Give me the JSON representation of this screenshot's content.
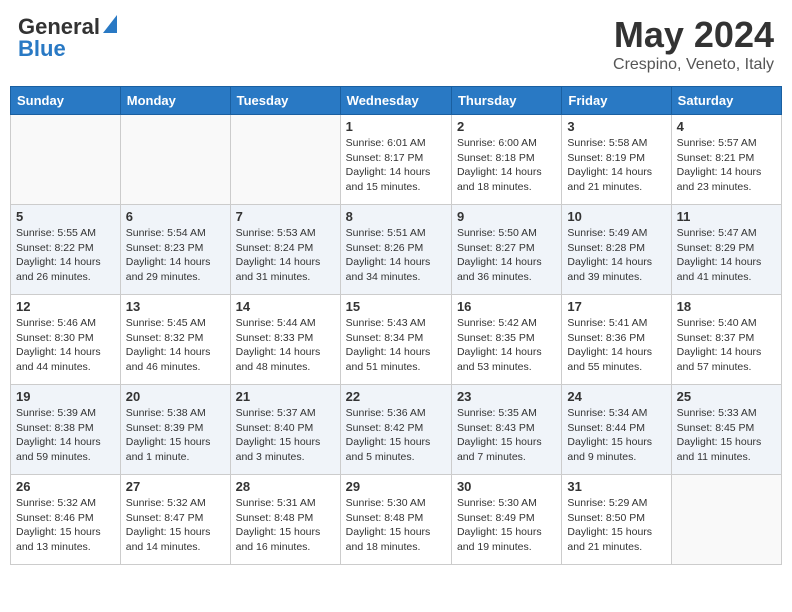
{
  "header": {
    "logo_general": "General",
    "logo_blue": "Blue",
    "month_title": "May 2024",
    "location": "Crespino, Veneto, Italy"
  },
  "days_of_week": [
    "Sunday",
    "Monday",
    "Tuesday",
    "Wednesday",
    "Thursday",
    "Friday",
    "Saturday"
  ],
  "weeks": [
    {
      "days": [
        {
          "number": "",
          "info": ""
        },
        {
          "number": "",
          "info": ""
        },
        {
          "number": "",
          "info": ""
        },
        {
          "number": "1",
          "info": "Sunrise: 6:01 AM\nSunset: 8:17 PM\nDaylight: 14 hours\nand 15 minutes."
        },
        {
          "number": "2",
          "info": "Sunrise: 6:00 AM\nSunset: 8:18 PM\nDaylight: 14 hours\nand 18 minutes."
        },
        {
          "number": "3",
          "info": "Sunrise: 5:58 AM\nSunset: 8:19 PM\nDaylight: 14 hours\nand 21 minutes."
        },
        {
          "number": "4",
          "info": "Sunrise: 5:57 AM\nSunset: 8:21 PM\nDaylight: 14 hours\nand 23 minutes."
        }
      ]
    },
    {
      "days": [
        {
          "number": "5",
          "info": "Sunrise: 5:55 AM\nSunset: 8:22 PM\nDaylight: 14 hours\nand 26 minutes."
        },
        {
          "number": "6",
          "info": "Sunrise: 5:54 AM\nSunset: 8:23 PM\nDaylight: 14 hours\nand 29 minutes."
        },
        {
          "number": "7",
          "info": "Sunrise: 5:53 AM\nSunset: 8:24 PM\nDaylight: 14 hours\nand 31 minutes."
        },
        {
          "number": "8",
          "info": "Sunrise: 5:51 AM\nSunset: 8:26 PM\nDaylight: 14 hours\nand 34 minutes."
        },
        {
          "number": "9",
          "info": "Sunrise: 5:50 AM\nSunset: 8:27 PM\nDaylight: 14 hours\nand 36 minutes."
        },
        {
          "number": "10",
          "info": "Sunrise: 5:49 AM\nSunset: 8:28 PM\nDaylight: 14 hours\nand 39 minutes."
        },
        {
          "number": "11",
          "info": "Sunrise: 5:47 AM\nSunset: 8:29 PM\nDaylight: 14 hours\nand 41 minutes."
        }
      ]
    },
    {
      "days": [
        {
          "number": "12",
          "info": "Sunrise: 5:46 AM\nSunset: 8:30 PM\nDaylight: 14 hours\nand 44 minutes."
        },
        {
          "number": "13",
          "info": "Sunrise: 5:45 AM\nSunset: 8:32 PM\nDaylight: 14 hours\nand 46 minutes."
        },
        {
          "number": "14",
          "info": "Sunrise: 5:44 AM\nSunset: 8:33 PM\nDaylight: 14 hours\nand 48 minutes."
        },
        {
          "number": "15",
          "info": "Sunrise: 5:43 AM\nSunset: 8:34 PM\nDaylight: 14 hours\nand 51 minutes."
        },
        {
          "number": "16",
          "info": "Sunrise: 5:42 AM\nSunset: 8:35 PM\nDaylight: 14 hours\nand 53 minutes."
        },
        {
          "number": "17",
          "info": "Sunrise: 5:41 AM\nSunset: 8:36 PM\nDaylight: 14 hours\nand 55 minutes."
        },
        {
          "number": "18",
          "info": "Sunrise: 5:40 AM\nSunset: 8:37 PM\nDaylight: 14 hours\nand 57 minutes."
        }
      ]
    },
    {
      "days": [
        {
          "number": "19",
          "info": "Sunrise: 5:39 AM\nSunset: 8:38 PM\nDaylight: 14 hours\nand 59 minutes."
        },
        {
          "number": "20",
          "info": "Sunrise: 5:38 AM\nSunset: 8:39 PM\nDaylight: 15 hours\nand 1 minute."
        },
        {
          "number": "21",
          "info": "Sunrise: 5:37 AM\nSunset: 8:40 PM\nDaylight: 15 hours\nand 3 minutes."
        },
        {
          "number": "22",
          "info": "Sunrise: 5:36 AM\nSunset: 8:42 PM\nDaylight: 15 hours\nand 5 minutes."
        },
        {
          "number": "23",
          "info": "Sunrise: 5:35 AM\nSunset: 8:43 PM\nDaylight: 15 hours\nand 7 minutes."
        },
        {
          "number": "24",
          "info": "Sunrise: 5:34 AM\nSunset: 8:44 PM\nDaylight: 15 hours\nand 9 minutes."
        },
        {
          "number": "25",
          "info": "Sunrise: 5:33 AM\nSunset: 8:45 PM\nDaylight: 15 hours\nand 11 minutes."
        }
      ]
    },
    {
      "days": [
        {
          "number": "26",
          "info": "Sunrise: 5:32 AM\nSunset: 8:46 PM\nDaylight: 15 hours\nand 13 minutes."
        },
        {
          "number": "27",
          "info": "Sunrise: 5:32 AM\nSunset: 8:47 PM\nDaylight: 15 hours\nand 14 minutes."
        },
        {
          "number": "28",
          "info": "Sunrise: 5:31 AM\nSunset: 8:48 PM\nDaylight: 15 hours\nand 16 minutes."
        },
        {
          "number": "29",
          "info": "Sunrise: 5:30 AM\nSunset: 8:48 PM\nDaylight: 15 hours\nand 18 minutes."
        },
        {
          "number": "30",
          "info": "Sunrise: 5:30 AM\nSunset: 8:49 PM\nDaylight: 15 hours\nand 19 minutes."
        },
        {
          "number": "31",
          "info": "Sunrise: 5:29 AM\nSunset: 8:50 PM\nDaylight: 15 hours\nand 21 minutes."
        },
        {
          "number": "",
          "info": ""
        }
      ]
    }
  ]
}
